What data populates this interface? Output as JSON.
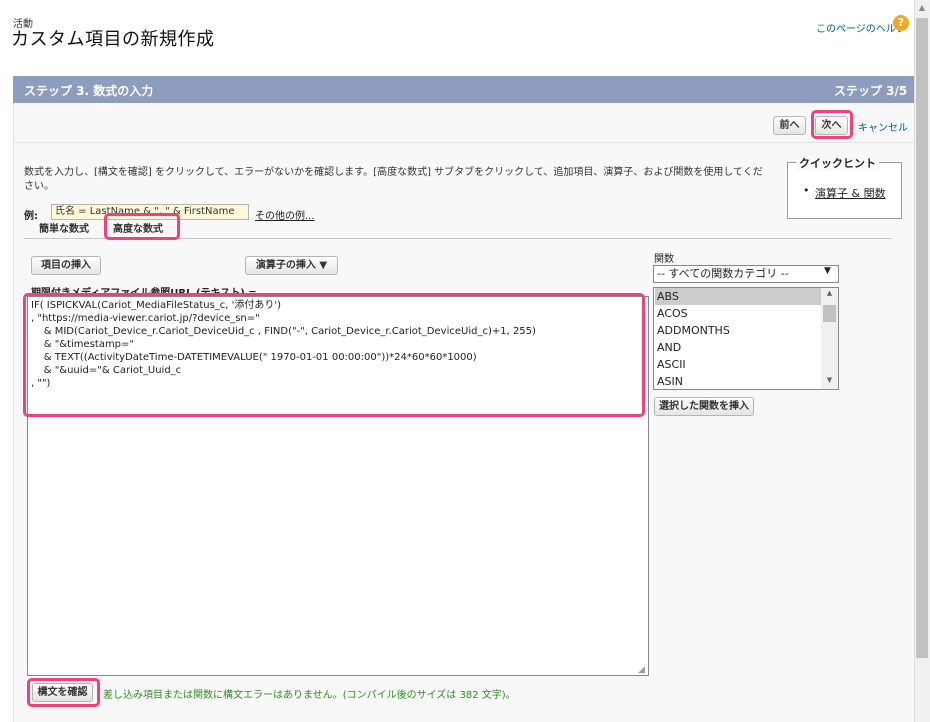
{
  "header": {
    "object_label": "活動",
    "page_title": "カスタム項目の新規作成",
    "help_link": "このページのヘルプ",
    "help_icon": "?"
  },
  "step": {
    "title": "ステップ 3. 数式の入力",
    "count": "ステップ 3/5"
  },
  "nav": {
    "prev_label": "前へ",
    "next_label": "次へ",
    "cancel_label": "キャンセル"
  },
  "instructions": "数式を入力し、[構文を確認] をクリックして、エラーがないかを確認します。[高度な数式] サブタブをクリックして、追加項目、演算子、および関数を使用してください。",
  "example": {
    "label": "例:",
    "value": "氏名 = LastName & \", \" & FirstName",
    "more_link": "その他の例..."
  },
  "quick_hint": {
    "title": "クイックヒント",
    "link": "演算子 & 関数"
  },
  "tabs": [
    {
      "label": "簡単な数式"
    },
    {
      "label": "高度な数式"
    }
  ],
  "toolbar": {
    "insert_field": "項目の挿入",
    "insert_operator": "演算子の挿入"
  },
  "formula": {
    "label": "期限付きメディアファイル参照URL (テキスト) =",
    "value": "IF( ISPICKVAL(Cariot_MediaFileStatus_c, '添付あり')\n, \"https://media-viewer.cariot.jp/?device_sn=\"\n    & MID(Cariot_Device_r.Cariot_DeviceUid_c , FIND(\"-\", Cariot_Device_r.Cariot_DeviceUid_c)+1, 255)\n    & \"&timestamp=\"\n    & TEXT((ActivityDateTime-DATETIMEVALUE(\" 1970-01-01 00:00:00\"))*24*60*60*1000)\n    & \"&uuid=\"& Cariot_Uuid_c\n, \"\")"
  },
  "functions": {
    "label": "関数",
    "category_selected": "-- すべての関数カテゴリ --",
    "items": [
      "ABS",
      "ACOS",
      "ADDMONTHS",
      "AND",
      "ASCII",
      "ASIN"
    ],
    "selected_index": 0,
    "insert_label": "選択した関数を挿入"
  },
  "check": {
    "button_label": "構文を確認",
    "message": "差し込み項目または関数に構文エラーはありません。(コンパイル後のサイズは 382 文字)。"
  },
  "colors": {
    "step_bar": "#8e9dbe",
    "highlight": "#f0427a",
    "link": "#015ba7",
    "success": "#2e8b22"
  }
}
